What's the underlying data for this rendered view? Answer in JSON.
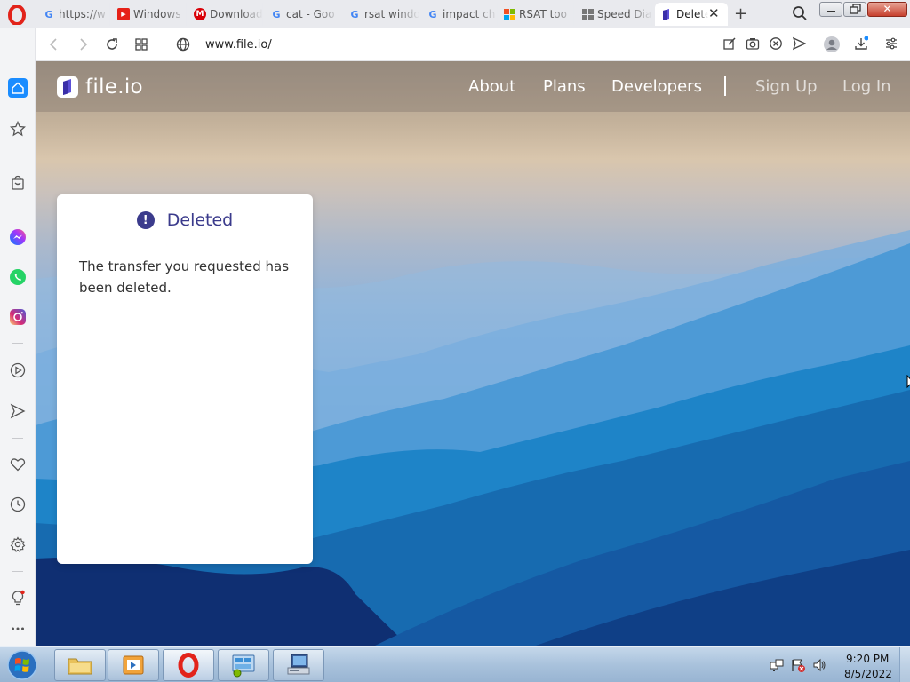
{
  "browser": {
    "tabs": [
      {
        "label": "https://w",
        "icon": "google-icon"
      },
      {
        "label": "Windows",
        "icon": "youtube-icon"
      },
      {
        "label": "Download",
        "icon": "mega-icon"
      },
      {
        "label": "cat - Goo",
        "icon": "google-icon"
      },
      {
        "label": "rsat windo",
        "icon": "google-icon"
      },
      {
        "label": "impact ch",
        "icon": "google-icon"
      },
      {
        "label": "RSAT too",
        "icon": "windows-icon"
      },
      {
        "label": "Speed Dia",
        "icon": "speed-dial-icon"
      },
      {
        "label": "Delete",
        "icon": "fileio-icon",
        "active": true
      }
    ],
    "url": "www.file.io/"
  },
  "site": {
    "logo_text": "file.io",
    "nav": {
      "about": "About",
      "plans": "Plans",
      "developers": "Developers",
      "sign_up": "Sign Up",
      "log_in": "Log In"
    },
    "card": {
      "title": "Deleted",
      "icon": "!",
      "message": "The transfer you requested has been deleted."
    }
  },
  "taskbar": {
    "time": "9:20 PM",
    "date": "8/5/2022"
  },
  "colors": {
    "accent": "#3b3b8c",
    "opera_red": "#e2231a",
    "sidebar_active": "#1a8cff"
  }
}
